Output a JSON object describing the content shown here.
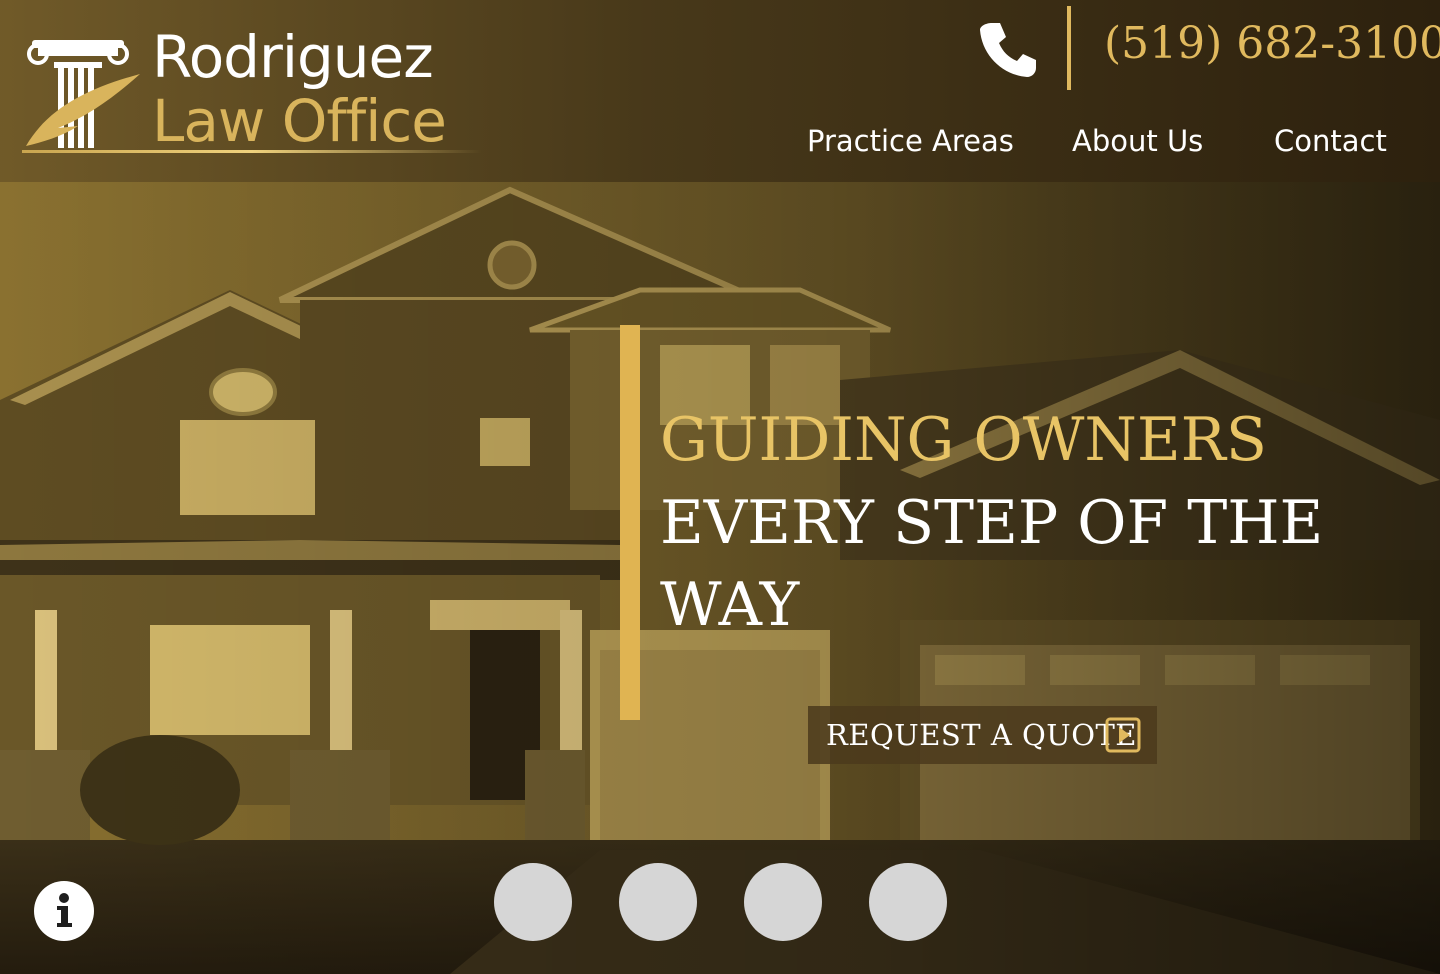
{
  "brand": {
    "name_line1": "Rodriguez",
    "name_line2": "Law Office"
  },
  "contact": {
    "phone": "(519) 682-3100",
    "phone_icon": "phone-icon"
  },
  "nav": {
    "items": [
      {
        "label": "Practice Areas"
      },
      {
        "label": "About Us"
      },
      {
        "label": "Contact"
      }
    ]
  },
  "hero": {
    "headline_gold": "GUIDING OWNERS",
    "headline_white_1": "EVERY STEP OF THE",
    "headline_white_2": "WAY",
    "cta_label": "REQUEST A QUOTE",
    "cta_icon": "play-square-icon"
  },
  "slider": {
    "dots": 4
  },
  "info_icon": "info-icon",
  "colors": {
    "gold": "#e0b95e",
    "gold_light": "#e8c466",
    "dark": "#2a2113",
    "white": "#ffffff",
    "dot": "#d6d6d6"
  }
}
